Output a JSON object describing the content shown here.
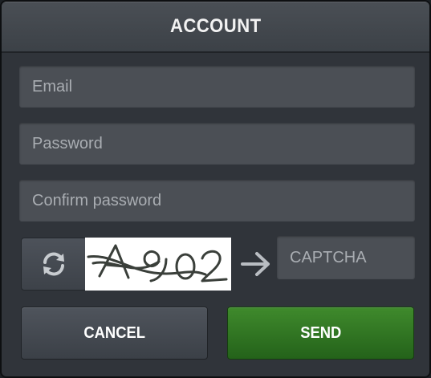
{
  "dialog": {
    "title": "ACCOUNT"
  },
  "form": {
    "email_placeholder": "Email",
    "password_placeholder": "Password",
    "confirm_password_placeholder": "Confirm password",
    "captcha_placeholder": "CAPTCHA",
    "captcha_image_text": "A902"
  },
  "buttons": {
    "cancel_label": "CANCEL",
    "send_label": "SEND"
  },
  "icons": {
    "refresh": "refresh-icon",
    "arrow": "arrow-right-icon"
  },
  "colors": {
    "send_button": "#2f7a22",
    "panel": "#30343a",
    "field": "#4b4f55"
  }
}
